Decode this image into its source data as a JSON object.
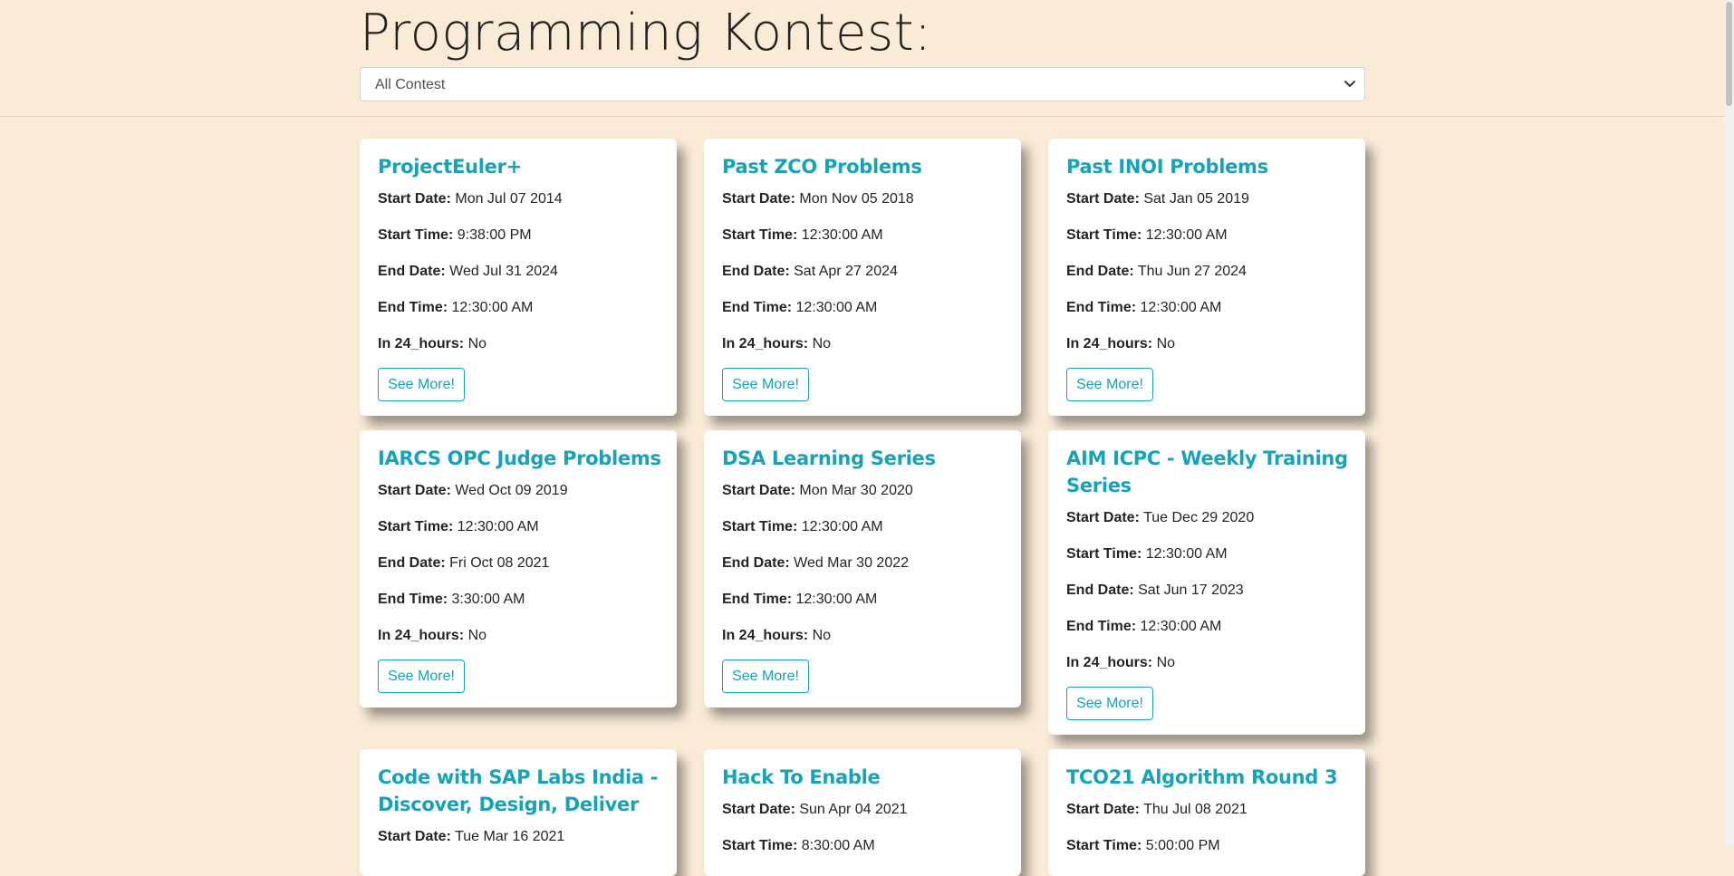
{
  "header": {
    "title": "Programming Kontest:",
    "filter_value": "All Contest"
  },
  "labels": {
    "start_date": "Start Date:",
    "start_time": "Start Time:",
    "end_date": "End Date:",
    "end_time": "End Time:",
    "in_24_hours": "In 24_hours:",
    "see_more": "See More!"
  },
  "contests": [
    {
      "name": "ProjectEuler+",
      "start_date": "Mon Jul 07 2014",
      "start_time": "9:38:00 PM",
      "end_date": "Wed Jul 31 2024",
      "end_time": "12:30:00 AM",
      "in_24_hours": "No"
    },
    {
      "name": "Past ZCO Problems",
      "start_date": "Mon Nov 05 2018",
      "start_time": "12:30:00 AM",
      "end_date": "Sat Apr 27 2024",
      "end_time": "12:30:00 AM",
      "in_24_hours": "No"
    },
    {
      "name": "Past INOI Problems",
      "start_date": "Sat Jan 05 2019",
      "start_time": "12:30:00 AM",
      "end_date": "Thu Jun 27 2024",
      "end_time": "12:30:00 AM",
      "in_24_hours": "No"
    },
    {
      "name": "IARCS OPC Judge Problems",
      "start_date": "Wed Oct 09 2019",
      "start_time": "12:30:00 AM",
      "end_date": "Fri Oct 08 2021",
      "end_time": "3:30:00 AM",
      "in_24_hours": "No"
    },
    {
      "name": "DSA Learning Series",
      "start_date": "Mon Mar 30 2020",
      "start_time": "12:30:00 AM",
      "end_date": "Wed Mar 30 2022",
      "end_time": "12:30:00 AM",
      "in_24_hours": "No"
    },
    {
      "name": "AIM ICPC - Weekly Training Series",
      "start_date": "Tue Dec 29 2020",
      "start_time": "12:30:00 AM",
      "end_date": "Sat Jun 17 2023",
      "end_time": "12:30:00 AM",
      "in_24_hours": "No"
    },
    {
      "name": "Code with SAP Labs India - Discover, Design, Deliver",
      "start_date": "Tue Mar 16 2021"
    },
    {
      "name": "Hack To Enable",
      "start_date": "Sun Apr 04 2021",
      "start_time": "8:30:00 AM"
    },
    {
      "name": "TCO21 Algorithm Round 3",
      "start_date": "Thu Jul 08 2021",
      "start_time": "5:00:00 PM"
    }
  ]
}
